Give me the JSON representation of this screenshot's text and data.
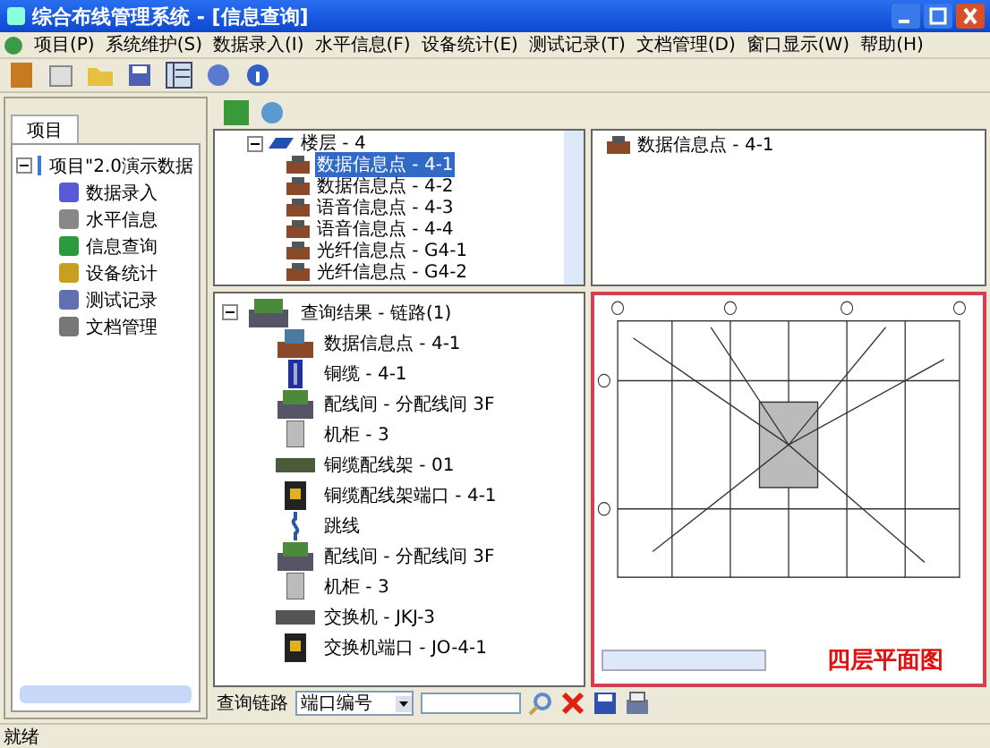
{
  "window": {
    "title": "综合布线管理系统 - [信息查询]"
  },
  "menu": [
    "项目(P)",
    "系统维护(S)",
    "数据录入(I)",
    "水平信息(F)",
    "设备统计(E)",
    "测试记录(T)",
    "文档管理(D)",
    "窗口显示(W)",
    "帮助(H)"
  ],
  "sidebar": {
    "tabs": [
      {
        "label": "项目",
        "selected": true
      }
    ],
    "tree": {
      "label": "项目\"2.0演示数据",
      "expanded": true,
      "children": [
        {
          "label": "数据录入",
          "kind": "entry"
        },
        {
          "label": "水平信息",
          "kind": "horizontal"
        },
        {
          "label": "信息查询",
          "kind": "query"
        },
        {
          "label": "设备统计",
          "kind": "stats"
        },
        {
          "label": "测试记录",
          "kind": "test"
        },
        {
          "label": "文档管理",
          "kind": "docs"
        }
      ]
    }
  },
  "location_tree": {
    "label": "楼层 - 4",
    "expanded": true,
    "children": [
      {
        "label": "数据信息点 - 4-1",
        "selected": true
      },
      {
        "label": "数据信息点 - 4-2",
        "selected": false
      },
      {
        "label": "语音信息点 - 4-3",
        "selected": false
      },
      {
        "label": "语音信息点 - 4-4",
        "selected": false
      },
      {
        "label": "光纤信息点 - G4-1",
        "selected": false
      },
      {
        "label": "光纤信息点 - G4-2",
        "selected": false
      }
    ]
  },
  "detail_list": [
    "数据信息点 - 4-1"
  ],
  "result_tree": {
    "label": "查询结果 - 链路(1)",
    "expanded": true,
    "children": [
      {
        "label": "数据信息点 - 4-1",
        "kind": "outlet"
      },
      {
        "label": "铜缆 - 4-1",
        "kind": "cable"
      },
      {
        "label": "配线间 - 分配线间 3F",
        "kind": "room"
      },
      {
        "label": "机柜 - 3",
        "kind": "cabinet"
      },
      {
        "label": "铜缆配线架 - 01",
        "kind": "panel"
      },
      {
        "label": "铜缆配线架端口 - 4-1",
        "kind": "port"
      },
      {
        "label": "跳线",
        "kind": "jumper"
      },
      {
        "label": "配线间 - 分配线间 3F",
        "kind": "room"
      },
      {
        "label": "机柜 - 3",
        "kind": "cabinet"
      },
      {
        "label": "交换机 - JKJ-3",
        "kind": "switch"
      },
      {
        "label": "交换机端口 - JO-4-1",
        "kind": "port"
      }
    ]
  },
  "floor_plan": {
    "caption": "四层平面图"
  },
  "query_bar": {
    "label": "查询链路",
    "field": "端口编号"
  },
  "status_bar": "就绪"
}
